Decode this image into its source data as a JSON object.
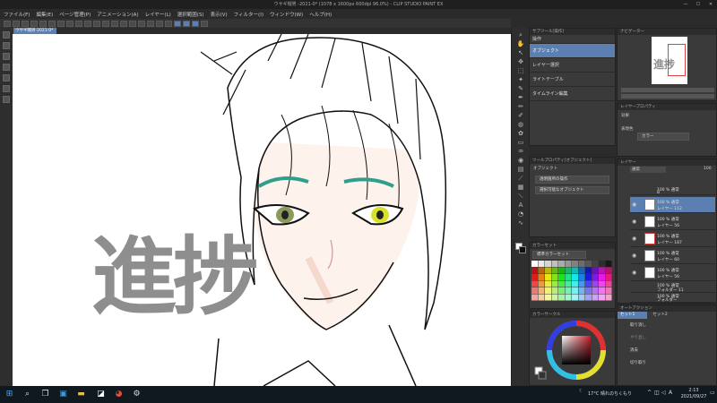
{
  "window": {
    "title": "ウサギ帽男 -2021-0* (1078 x 1600px 600dpi 96.0%) - CLIP STUDIO PAINT EX",
    "minimize": "—",
    "maximize": "☐",
    "close": "✕"
  },
  "menu": [
    "ファイル(F)",
    "編集(E)",
    "ページ管理(P)",
    "アニメーション(A)",
    "レイヤー(L)",
    "選択範囲(S)",
    "表示(V)",
    "フィルター(I)",
    "ウィンドウ(W)",
    "ヘルプ(H)"
  ],
  "document_tab": "ウサギ帽男-2021-0*",
  "canvas": {
    "overlay_text": "進捗"
  },
  "subtool_panel": {
    "title": "サブツール[操作]",
    "items": [
      "操作",
      "オブジェクト",
      "レイヤー選択",
      "ライトテーブル",
      "タイムライン編集"
    ],
    "selected_index": 1
  },
  "tool_property": {
    "title": "ツールプロパティ[オブジェクト]",
    "subtitle": "オブジェクト",
    "field1": "透明箇所の操作",
    "field2": "選択可能なオブジェクト"
  },
  "color_set": {
    "title": "カラーセット",
    "name": "標準カラーセット"
  },
  "color_wheel": {
    "title": "カラーサークル"
  },
  "navigator": {
    "title": "ナビゲーター",
    "preview_text": "進捗"
  },
  "layer_property": {
    "title": "レイヤープロパティ",
    "effect_label": "効果",
    "expression_label": "表現色",
    "expression_value": "カラー"
  },
  "layer_panel": {
    "title": "レイヤー",
    "blend_mode": "通常",
    "opacity": "100",
    "rows": [
      {
        "l1": "100 % 通常",
        "l2": "B"
      },
      {
        "l1": "100 % 通常",
        "l2": "レイヤー 112"
      },
      {
        "l1": "100 % 通常",
        "l2": "レイヤー 56"
      },
      {
        "l1": "100 % 通常",
        "l2": "レイヤー 187"
      },
      {
        "l1": "100 % 通常",
        "l2": "レイヤー 60"
      },
      {
        "l1": "100 % 通常",
        "l2": "レイヤー 56"
      },
      {
        "l1": "100 % 通常",
        "l2": "フォルダー 11"
      },
      {
        "l1": "100 % 通常",
        "l2": "フォルダー"
      }
    ]
  },
  "autoaction_panel": {
    "title": "オートアクション",
    "tabs": [
      "セット1",
      "セット2"
    ],
    "items": [
      "取り消し",
      "やり直し",
      "消去",
      "切り取り"
    ]
  },
  "taskbar": {
    "weather": "17°C 晴れのちくもり",
    "time": "2:13",
    "date": "2021/09/27",
    "ime": "A"
  },
  "colors": {
    "accent": "#5b7fb0",
    "panel": "#3a3a3a",
    "text_overlay": "#8e8e8e"
  }
}
